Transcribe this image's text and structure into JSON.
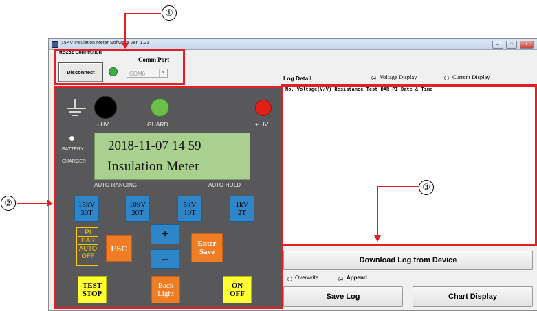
{
  "window": {
    "title": "15KV Insulation Meter Software Ver. 1.21",
    "controls": {
      "minimize": "–",
      "maximize": "□",
      "close": "x"
    }
  },
  "callouts": [
    "①",
    "②",
    "③"
  ],
  "rs232": {
    "label": "RS232 Connection",
    "disconnect_label": "Disconnect",
    "comm_port_label": "Comm Port",
    "comm_port_value": "COM6",
    "status_led_color": "#3cb043"
  },
  "panel": {
    "minus_hv": "- HV",
    "guard": "GUARD",
    "plus_hv": "+ HV",
    "battery": "BATTERY",
    "charger": "CHARGER",
    "lcd_line1": "2018-11-07 14 59",
    "lcd_line2": "Insulation Meter",
    "auto_ranging": "AUTO-RANGING",
    "auto_hold": "AUTO-HOLD",
    "range_buttons": [
      {
        "top": "15kV",
        "bottom": "30T"
      },
      {
        "top": "10kV",
        "bottom": "20T"
      },
      {
        "top": "5kV",
        "bottom": "10T"
      },
      {
        "top": "1kV",
        "bottom": "2T"
      }
    ],
    "modes": [
      "PI",
      "DAR",
      "AUTO",
      "OFF"
    ],
    "esc": "ESC",
    "plus": "+",
    "minus": "–",
    "enter_top": "Enter",
    "enter_bottom": "Save",
    "test_top": "TEST",
    "test_bottom": "STOP",
    "back_top": "Back",
    "back_bottom": "Light",
    "on": "ON",
    "off": "OFF"
  },
  "log": {
    "label": "Log Detail",
    "voltage_display": "Voltage Display",
    "current_display": "Current Display",
    "selected_display": "Voltage Display",
    "header": "No. Voltage(V/V) Resistance  Test  DAR  PI    Date & Time",
    "download_button": "Download Log from Device",
    "overwrite": "Overwrite",
    "append": "Append",
    "selected_mode": "Append",
    "save_log_button": "Save Log",
    "chart_display_button": "Chart Display"
  },
  "colors": {
    "highlight_red": "#e31e24",
    "panel_bg": "#58585a",
    "lcd_green": "#a9d08e",
    "range_blue": "#2e86c9",
    "orange": "#f07d24",
    "yellow": "#ffff33"
  }
}
